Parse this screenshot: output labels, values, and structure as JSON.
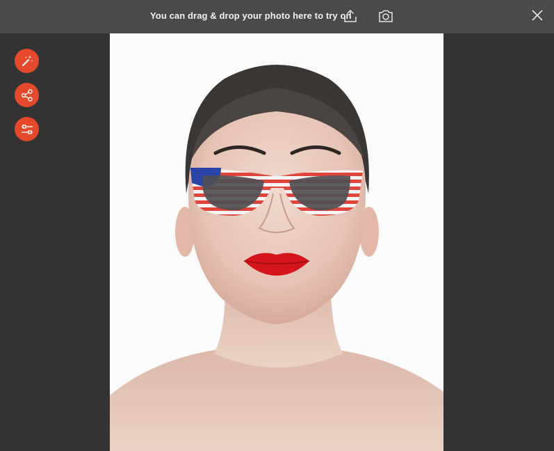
{
  "topbar": {
    "message": "You can drag & drop your photo here to try on",
    "upload_icon": "upload-icon",
    "camera_icon": "camera-icon",
    "close_icon": "close-icon"
  },
  "sidebar": {
    "items": [
      {
        "icon": "magic-wand-icon"
      },
      {
        "icon": "share-icon"
      },
      {
        "icon": "sliders-icon"
      }
    ]
  },
  "photo": {
    "subject": "woman-portrait",
    "overlay": "american-flag-sunglasses"
  },
  "colors": {
    "topbar_bg": "#4a4a4a",
    "page_bg": "#333333",
    "accent": "#e4492c"
  }
}
